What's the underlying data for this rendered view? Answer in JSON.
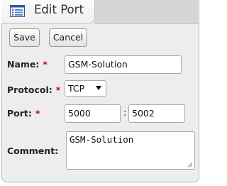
{
  "tab": {
    "title": "Edit Port",
    "icon": "list-form-icon"
  },
  "toolbar": {
    "save_label": "Save",
    "cancel_label": "Cancel"
  },
  "form": {
    "name": {
      "label": "Name:",
      "required_mark": "*",
      "value": "GSM-Solution"
    },
    "protocol": {
      "label": "Protocol:",
      "required_mark": "*",
      "selected": "TCP"
    },
    "port": {
      "label": "Port:",
      "required_mark": "*",
      "start": "5000",
      "separator": ":",
      "end": "5002"
    },
    "comment": {
      "label": "Comment:",
      "value": "GSM-Solution"
    }
  },
  "colors": {
    "required": "#cc0000",
    "panel": "#ededed"
  }
}
